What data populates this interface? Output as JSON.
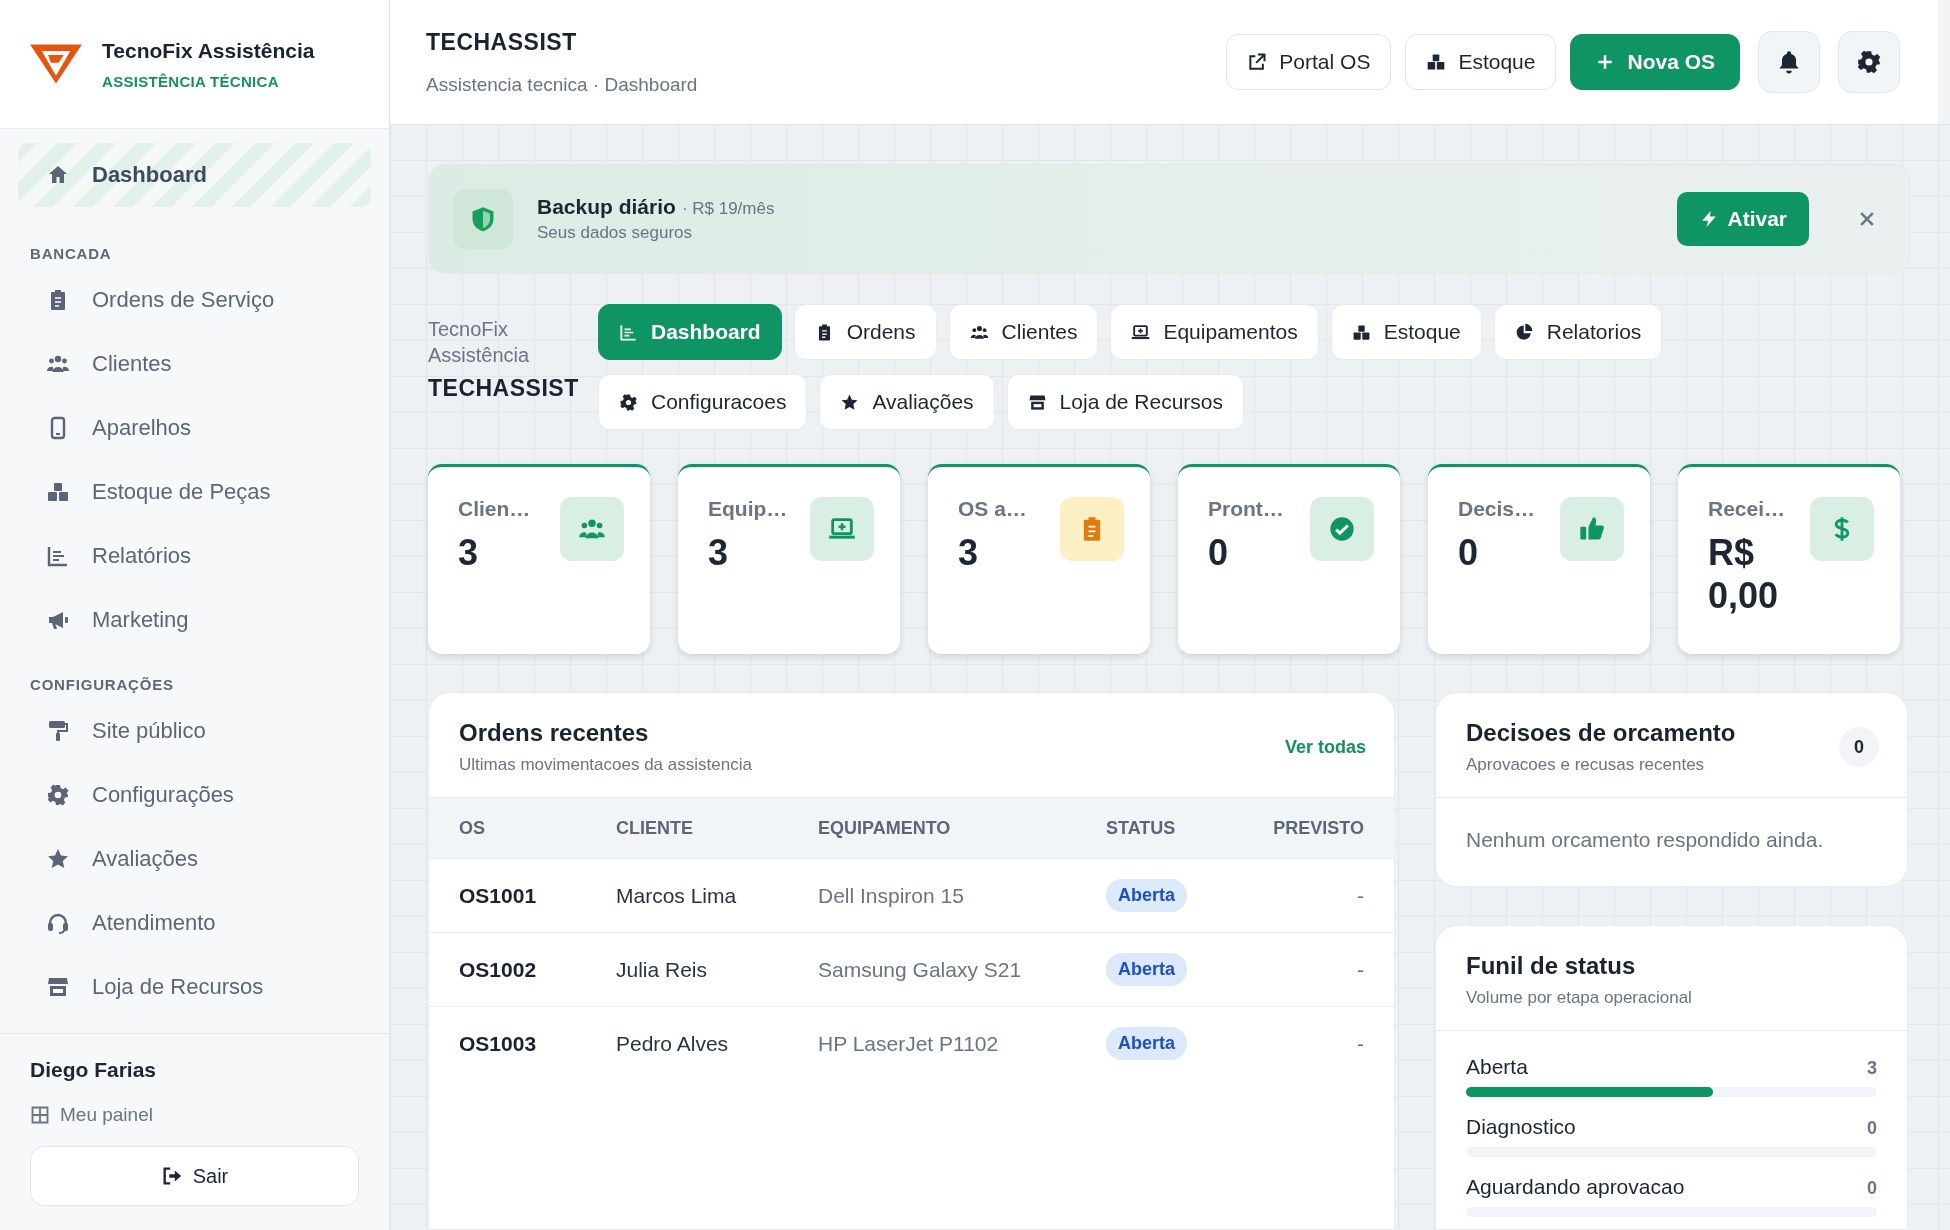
{
  "brand": {
    "name": "TecnoFix Assistência",
    "tagline": "ASSISTÊNCIA TÉCNICA"
  },
  "sidebar": {
    "top": [
      {
        "label": "Dashboard",
        "selected": true
      }
    ],
    "sections": [
      {
        "title": "BANCADA",
        "items": [
          {
            "label": "Ordens de Serviço",
            "selected": false
          },
          {
            "label": "Clientes",
            "selected": false
          },
          {
            "label": "Aparelhos",
            "selected": false
          },
          {
            "label": "Estoque de Peças",
            "selected": false
          },
          {
            "label": "Relatórios",
            "selected": false
          },
          {
            "label": "Marketing",
            "selected": false
          }
        ]
      },
      {
        "title": "CONFIGURAÇÕES",
        "items": [
          {
            "label": "Site público",
            "selected": false
          },
          {
            "label": "Configurações",
            "selected": false
          },
          {
            "label": "Avaliações",
            "selected": false
          },
          {
            "label": "Atendimento",
            "selected": false
          },
          {
            "label": "Loja de Recursos",
            "selected": false
          }
        ]
      }
    ]
  },
  "user": {
    "name": "Diego Farias",
    "link": "Meu painel",
    "logout": "Sair"
  },
  "header": {
    "title": "TECHASSIST",
    "breadcrumb": "Assistencia tecnica · Dashboard",
    "buttons": [
      {
        "label": "Portal OS",
        "kind": "outline"
      },
      {
        "label": "Estoque",
        "kind": "outline"
      },
      {
        "label": "Nova OS",
        "kind": "primary"
      }
    ]
  },
  "banner": {
    "title": "Backup diário",
    "price": "· R$ 19/mês",
    "subtitle": "Seus dados seguros",
    "action": "Ativar"
  },
  "module": {
    "name": "TecnoFix Assistência",
    "title": "TECHASSIST"
  },
  "tabs": [
    {
      "label": "Dashboard",
      "selected": true
    },
    {
      "label": "Ordens",
      "selected": false
    },
    {
      "label": "Clientes",
      "selected": false
    },
    {
      "label": "Equipamentos",
      "selected": false
    },
    {
      "label": "Estoque",
      "selected": false
    },
    {
      "label": "Relatorios",
      "selected": false
    },
    {
      "label": "Configuracoes",
      "selected": false
    },
    {
      "label": "Avaliações",
      "selected": false
    },
    {
      "label": "Loja de Recursos",
      "selected": false
    }
  ],
  "stats": [
    {
      "label": "Clien…",
      "value": "3",
      "kind": "success"
    },
    {
      "label": "Equip…",
      "value": "3",
      "kind": "success"
    },
    {
      "label": "OS a…",
      "value": "3",
      "kind": "warning"
    },
    {
      "label": "Pront…",
      "value": "0",
      "kind": "success"
    },
    {
      "label": "Decis…",
      "value": "0",
      "kind": "success"
    },
    {
      "label": "Recei…",
      "value": "R$ 0,00",
      "kind": "success"
    }
  ],
  "recent_orders": {
    "title": "Ordens recentes",
    "subtitle": "Ultimas movimentacoes da assistencia",
    "link": "Ver todas",
    "columns": [
      "OS",
      "CLIENTE",
      "EQUIPAMENTO",
      "STATUS",
      "PREVISTO"
    ],
    "rows": [
      {
        "os": "OS1001",
        "client": "Marcos Lima",
        "device": "Dell Inspiron 15",
        "status": "Aberta",
        "due": "-"
      },
      {
        "os": "OS1002",
        "client": "Julia Reis",
        "device": "Samsung Galaxy S21",
        "status": "Aberta",
        "due": "-"
      },
      {
        "os": "OS1003",
        "client": "Pedro Alves",
        "device": "HP LaserJet P1102",
        "status": "Aberta",
        "due": "-"
      }
    ]
  },
  "decisions": {
    "title": "Decisoes de orcamento",
    "subtitle": "Aprovacoes e recusas recentes",
    "count": "0",
    "empty": "Nenhum orcamento respondido ainda."
  },
  "funnel": {
    "title": "Funil de status",
    "subtitle": "Volume por etapa operacional",
    "stages": [
      {
        "label": "Aberta",
        "count": "3",
        "level": 0.6
      },
      {
        "label": "Diagnostico",
        "count": "0"
      },
      {
        "label": "Aguardando aprovacao",
        "count": "0"
      }
    ]
  }
}
